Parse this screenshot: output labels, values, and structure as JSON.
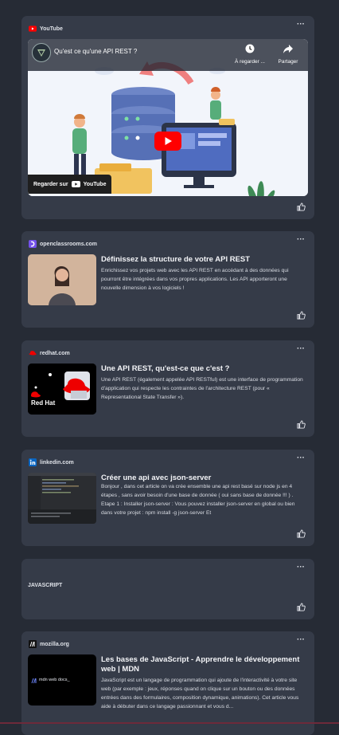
{
  "cards": [
    {
      "source": "YouTube",
      "video_title": "Qu'est ce qu'une API REST ?",
      "watch_later": "À regarder ...",
      "share": "Partager",
      "watch_on": "Regarder sur",
      "watch_on_brand": "YouTube"
    },
    {
      "source": "openclassrooms.com",
      "title": "Définissez la structure de votre API REST",
      "description": "Enrichissez vos projets web avec les API REST en accédant à des données qui pourront être intégrées dans vos propres applications. Les API apporteront une nouvelle dimension à vos logiciels !"
    },
    {
      "source": "redhat.com",
      "title": "Une API REST, qu'est-ce que c'est ?",
      "description": "Une API REST (également appelée API RESTful) est une interface de programmation d'application qui respecte les contraintes de l'architecture REST (pour « Representational State Transfer »).",
      "thumb_label": "Red Hat"
    },
    {
      "source": "linkedin.com",
      "title": "Créer une api avec json-server",
      "description": "Bonjour , dans cet article on va crée ensemble une api rest basé sur node js en 4 étapes , sans avoir besoin d'une base de donnée ( oui sans base de donnée !!! ) . Etape 1 : Installer json-server : Vous pouvez installer json-server en global ou bien dans votre projet : npm install -g json-server Et"
    },
    {
      "text": "JAVASCRIPT"
    },
    {
      "source": "mozilla.org",
      "title": "Les bases de JavaScript - Apprendre le développement web | MDN",
      "description": "JavaScript est un langage de programmation qui ajoute de l'interactivité à votre site web (par exemple : jeux, réponses quand on clique sur un bouton ou des données entrées dans des formulaires, composition dynamique, animations). Cet article vous aide à débuter dans ce langage passionnant et vous d...",
      "thumb_label": "mdn web docs_"
    }
  ],
  "more_label": "···",
  "icons": [
    "youtube-icon",
    "openclassrooms-icon",
    "redhat-icon",
    "linkedin-icon",
    "mdn-icon",
    "thumbs-up-icon",
    "clock-icon",
    "share-icon",
    "play-icon"
  ],
  "colors": {
    "background": "#262b35",
    "card": "#353b48",
    "youtube_red": "#ff0000",
    "linkedin_blue": "#0a66c2",
    "openclassrooms_purple": "#7451eb",
    "redhat_red": "#ee0000"
  }
}
